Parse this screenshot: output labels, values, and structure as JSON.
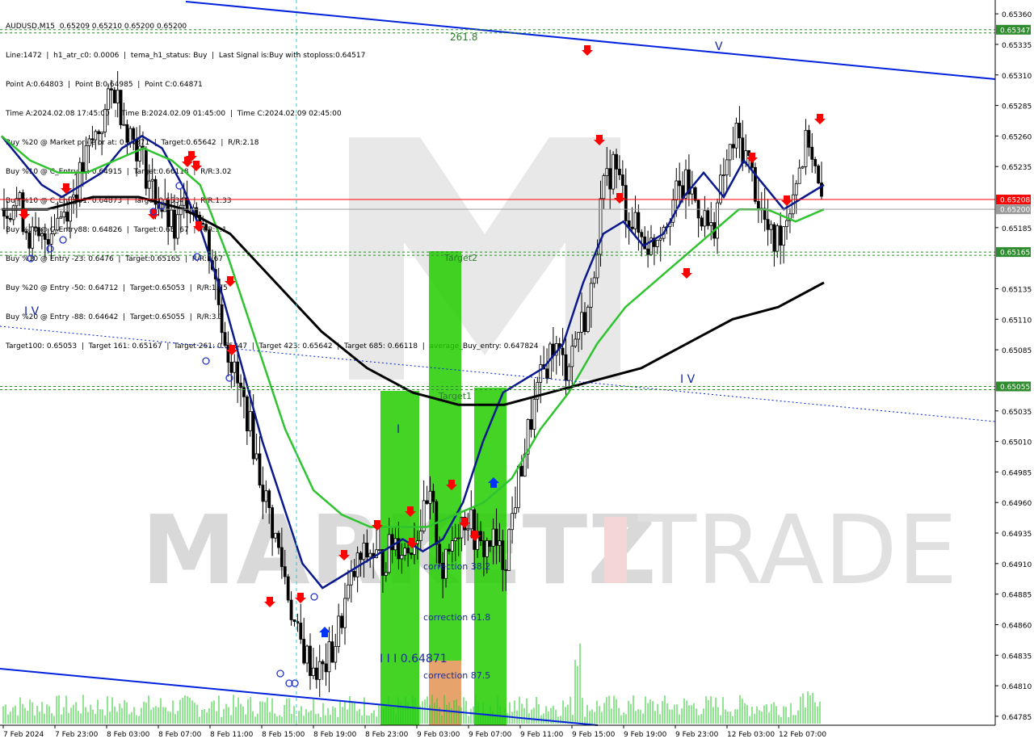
{
  "window": {
    "symbol_line": "AUDUSD,M15  0.65209 0.65210 0.65200 0.65200"
  },
  "info_lines": [
    "Line:1472  |  h1_atr_c0: 0.0006  |  tema_h1_status: Buy  |  Last Signal is:Buy with stoploss:0.64517",
    "Point A:0.64803  |  Point B:0.64985  |  Point C:0.64871",
    "Time A:2024.02.08 17:45:00  |  Time B:2024.02.09 01:45:00  |  Time C:2024.02.09 02:45:00",
    "Buy %20 @ Market price or at: 0.64871  |  Target:0.65642  |  R/R:2.18",
    "Buy %10 @ C_Entry38: 0.64915  |  Target:0.66118  |  R/R:3.02",
    "Buy %10 @ C_Entry61: 0.64873  |  Target:0.65347  |  R/R:1.33",
    "Buy %10 @ C_Entry88: 0.64826  |  Target:0.65167  |  R/R:1.1",
    "Buy %10 @ Entry -23: 0.6476  |  Target:0.65165  |  R/R:1.67",
    "Buy %20 @ Entry -50: 0.64712  |  Target:0.65053  |  R/R:1.75",
    "Buy %20 @ Entry -88: 0.64642  |  Target:0.65055  |  R/R:3.3",
    "Target100: 0.65053  |  Target 161: 0.65167  |  Target 261: 0.65347  |  Target 423: 0.65642  |  Target 685: 0.66118  |  average_Buy_entry: 0.647824"
  ],
  "watermark": {
    "left": "MARKETZ",
    "mid": "I",
    "right": "TRADE"
  },
  "annotations": {
    "fib_261": "261.8",
    "wave_I": "I",
    "wave_III": "I I I 0.64871",
    "wave_IV_left": "I V",
    "wave_IV_right": "I V",
    "wave_V": "V",
    "target1": "Target1",
    "target2": "Target2",
    "corr_38": "correction 38.2",
    "corr_61": "correction 61.8",
    "corr_87": "correction 87.5"
  },
  "price_badges": [
    {
      "label": "0.65347",
      "value": 0.65347,
      "color": "#2e8b2e"
    },
    {
      "label": "0.65208",
      "value": 0.65208,
      "color": "#ff0000"
    },
    {
      "label": "0.65200",
      "value": 0.652,
      "color": "#9a9a9a"
    },
    {
      "label": "0.65165",
      "value": 0.65165,
      "color": "#2e8b2e"
    },
    {
      "label": "0.65055",
      "value": 0.65055,
      "color": "#2e8b2e"
    }
  ],
  "colors": {
    "up": "#000000",
    "down": "#000000",
    "ma_fast": "#0a1a8c",
    "ma_mid": "#2fc42f",
    "ma_slow": "#000000",
    "channel": "#0022dd",
    "signal_red": "#ff0000",
    "signal_blue": "#0033ff",
    "green_zone": "#22cc00",
    "orange_zone": "#f0a070"
  },
  "chart_data": {
    "type": "candlestick",
    "symbol": "AUDUSD",
    "timeframe": "M15",
    "ohlc_current": {
      "open": 0.65209,
      "high": 0.6521,
      "low": 0.652,
      "close": 0.652
    },
    "y_ticks": [
      "0.65360",
      "0.65335",
      "0.65310",
      "0.65285",
      "0.65260",
      "0.65235",
      "0.65185",
      "0.65135",
      "0.65110",
      "0.65085",
      "0.65035",
      "0.65010",
      "0.64985",
      "0.64960",
      "0.64935",
      "0.64910",
      "0.64885",
      "0.64860",
      "0.64835",
      "0.64810",
      "0.64785"
    ],
    "x_ticks": [
      "7 Feb 2024",
      "7 Feb 23:00",
      "8 Feb 03:00",
      "8 Feb 07:00",
      "8 Feb 11:00",
      "8 Feb 15:00",
      "8 Feb 19:00",
      "8 Feb 23:00",
      "9 Feb 03:00",
      "9 Feb 07:00",
      "9 Feb 11:00",
      "9 Feb 15:00",
      "9 Feb 19:00",
      "9 Feb 23:00",
      "12 Feb 03:00",
      "12 Feb 07:00"
    ],
    "ylim": [
      0.64779,
      0.6537
    ],
    "levels": [
      {
        "name": "Target 261",
        "value": 0.65347
      },
      {
        "name": "last price line",
        "value": 0.65208
      },
      {
        "name": "bid",
        "value": 0.652
      },
      {
        "name": "Target 161",
        "value": 0.65165
      },
      {
        "name": "Target 100",
        "value": 0.65055
      }
    ],
    "close_path": [
      0.652,
      0.6521,
      0.6518,
      0.6517,
      0.6519,
      0.652,
      0.6522,
      0.6525,
      0.6527,
      0.653,
      0.6527,
      0.6525,
      0.6522,
      0.652,
      0.6518,
      0.6521,
      0.652,
      0.6516,
      0.651,
      0.6506,
      0.6503,
      0.6498,
      0.6494,
      0.649,
      0.6485,
      0.6483,
      0.6482,
      0.6484,
      0.6488,
      0.6491,
      0.6492,
      0.6491,
      0.6493,
      0.6492,
      0.6494,
      0.6496,
      0.649,
      0.6494,
      0.6495,
      0.6492,
      0.6493,
      0.6491,
      0.6497,
      0.6502,
      0.6506,
      0.6509,
      0.6507,
      0.651,
      0.6512,
      0.6521,
      0.6524,
      0.652,
      0.6518,
      0.6517,
      0.6519,
      0.6521,
      0.6522,
      0.652,
      0.6518,
      0.6523,
      0.6526,
      0.6524,
      0.652,
      0.6517,
      0.6519,
      0.6523,
      0.6526,
      0.652
    ],
    "moving_averages": [
      {
        "name": "fast",
        "color": "#0a1a8c",
        "values": [
          0.6526,
          0.6524,
          0.6522,
          0.6521,
          0.6522,
          0.6523,
          0.6525,
          0.6526,
          0.6525,
          0.6522,
          0.6518,
          0.6513,
          0.6507,
          0.6501,
          0.6496,
          0.6491,
          0.6489,
          0.649,
          0.6491,
          0.6492,
          0.6493,
          0.6492,
          0.6493,
          0.6496,
          0.6501,
          0.6505,
          0.6506,
          0.6507,
          0.6509,
          0.6514,
          0.6518,
          0.6519,
          0.6517,
          0.6518,
          0.6521,
          0.6523,
          0.6521,
          0.6524,
          0.6522,
          0.652,
          0.6521,
          0.6522
        ]
      },
      {
        "name": "mid",
        "color": "#2fc42f",
        "values": [
          0.6526,
          0.6524,
          0.6523,
          0.6523,
          0.6524,
          0.6525,
          0.6524,
          0.6522,
          0.6516,
          0.6509,
          0.6502,
          0.6497,
          0.6495,
          0.6494,
          0.6494,
          0.6494,
          0.6495,
          0.6496,
          0.6498,
          0.6502,
          0.6505,
          0.6509,
          0.6512,
          0.6514,
          0.6516,
          0.6518,
          0.652,
          0.652,
          0.6519,
          0.652
        ]
      },
      {
        "name": "slow",
        "color": "#000000",
        "values": [
          0.652,
          0.652,
          0.6521,
          0.6521,
          0.652,
          0.6518,
          0.6514,
          0.651,
          0.6507,
          0.6505,
          0.6504,
          0.6504,
          0.6505,
          0.6506,
          0.6507,
          0.6509,
          0.6511,
          0.6512,
          0.6514
        ]
      }
    ]
  }
}
